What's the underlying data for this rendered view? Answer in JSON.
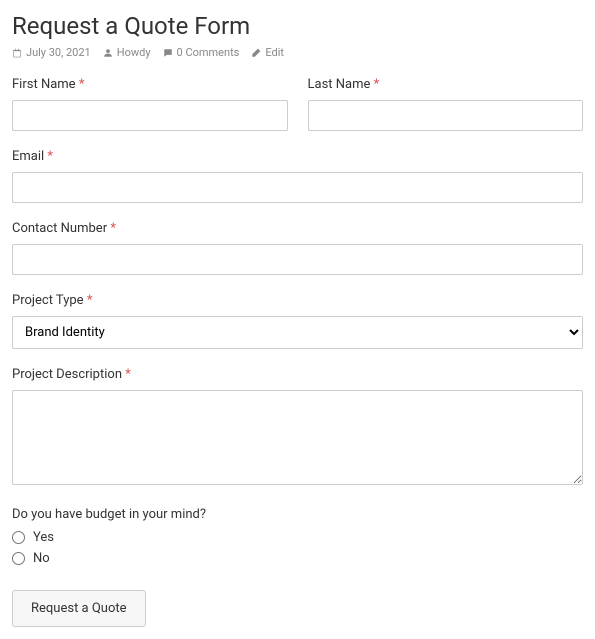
{
  "header": {
    "title": "Request a Quote Form",
    "meta": {
      "date": "July 30, 2021",
      "author": "Howdy",
      "comments": "0 Comments",
      "edit": "Edit"
    }
  },
  "form": {
    "first_name": {
      "label": "First Name",
      "value": ""
    },
    "last_name": {
      "label": "Last Name",
      "value": ""
    },
    "email": {
      "label": "Email",
      "value": ""
    },
    "contact_number": {
      "label": "Contact Number",
      "value": ""
    },
    "project_type": {
      "label": "Project Type",
      "selected": "Brand Identity"
    },
    "project_description": {
      "label": "Project Description",
      "value": ""
    },
    "budget": {
      "label": "Do you have budget in your mind?",
      "option_yes": "Yes",
      "option_no": "No"
    },
    "submit_label": "Request a Quote"
  }
}
